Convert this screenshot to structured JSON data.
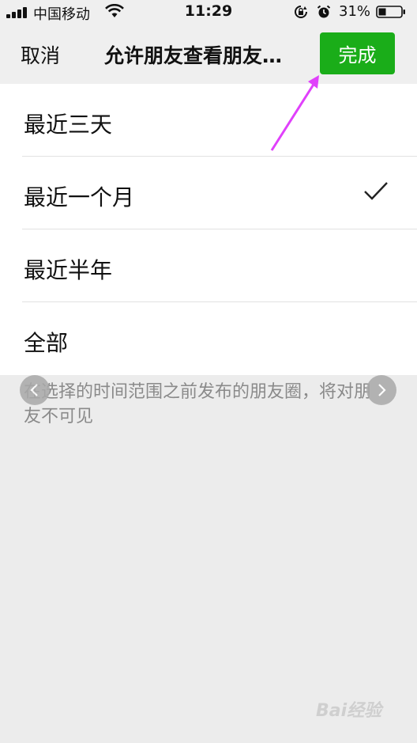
{
  "status_bar": {
    "carrier": "中国移动",
    "time": "11:29",
    "battery_percent": "31%",
    "icons": [
      "signal-icon",
      "wifi-icon",
      "rotation-lock-icon",
      "alarm-icon",
      "battery-icon"
    ]
  },
  "nav": {
    "cancel_label": "取消",
    "title": "允许朋友查看朋友…",
    "done_label": "完成",
    "done_color": "#1aad19"
  },
  "options": [
    {
      "label": "最近三天",
      "selected": false
    },
    {
      "label": "最近一个月",
      "selected": true
    },
    {
      "label": "最近半年",
      "selected": false
    },
    {
      "label": "全部",
      "selected": false
    }
  ],
  "hint": "在选择的时间范围之前发布的朋友圈，将对朋友不可见",
  "annotation": {
    "arrow_color": "#e040fb"
  },
  "watermark": "Bai经验"
}
